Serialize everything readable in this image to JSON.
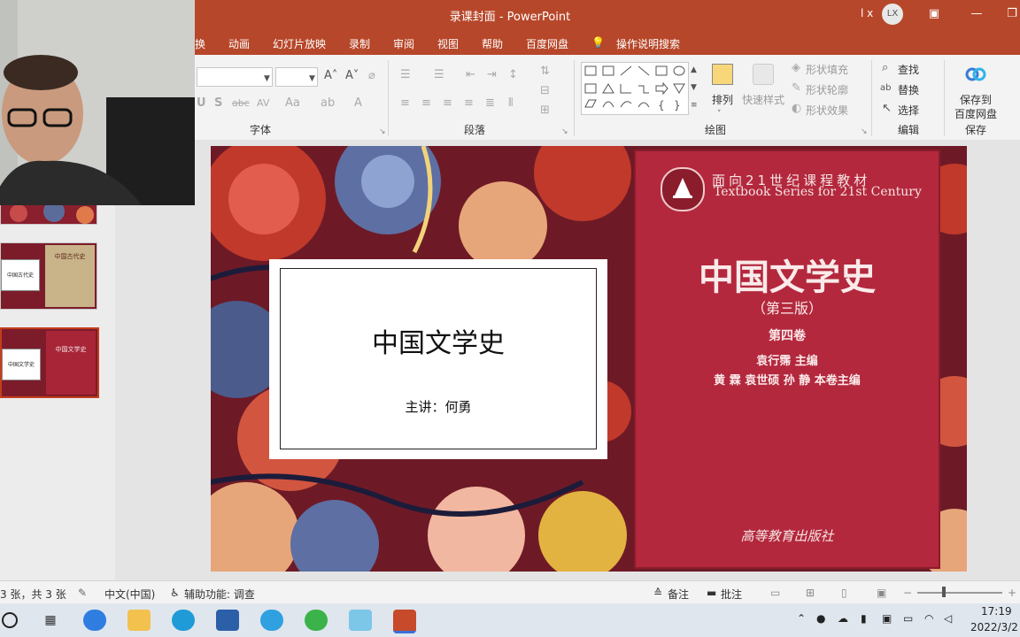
{
  "titlebar": {
    "title": "录课封面  -  PowerPoint",
    "user_name": "l x",
    "avatar_initials": "LX"
  },
  "tabs": [
    "换",
    "动画",
    "幻灯片放映",
    "录制",
    "审阅",
    "视图",
    "帮助",
    "百度网盘",
    "操作说明搜索"
  ],
  "ribbon": {
    "font_group": "字体",
    "paragraph_group": "段落",
    "drawing_group": "绘图",
    "editing_group": "编辑",
    "save_group": "保存",
    "arrange": "排列",
    "quick_styles": "快速样式",
    "shape_fill": "形状填充",
    "shape_outline": "形状轮廓",
    "shape_effects": "形状效果",
    "find": "查找",
    "replace": "替换",
    "select": "选择",
    "save_to_baidu_line1": "保存到",
    "save_to_baidu_line2": "百度网盘"
  },
  "slide": {
    "title": "中国文学史",
    "subtitle": "主讲：何勇",
    "book": {
      "series_cn": "面向21世纪课程教材",
      "series_en": "Textbook Series for 21st Century",
      "title": "中国文学史",
      "edition": "（第三版）",
      "volume": "第四卷",
      "chief_editor": "袁行霈  主编",
      "volume_editors": "黄  霖  袁世硕  孙  静  本卷主编",
      "publisher": "高等教育出版社"
    }
  },
  "thumbnails": [
    {
      "label": ""
    },
    {
      "label": "中国古代史",
      "book_title": "中国古代史"
    },
    {
      "label": "中国文学史",
      "book_title": "中国文学史"
    }
  ],
  "statusbar": {
    "slide_count": "3 张，共 3 张",
    "language": "中文(中国)",
    "accessibility": "辅助功能: 调查",
    "notes": "备注",
    "comments": "批注"
  },
  "taskbar": {
    "time": "17:19",
    "date": "2022/3/2"
  },
  "colors": {
    "accent": "#b7472a",
    "slide_bg": "#6e1a26",
    "book_red": "#b3283d"
  }
}
